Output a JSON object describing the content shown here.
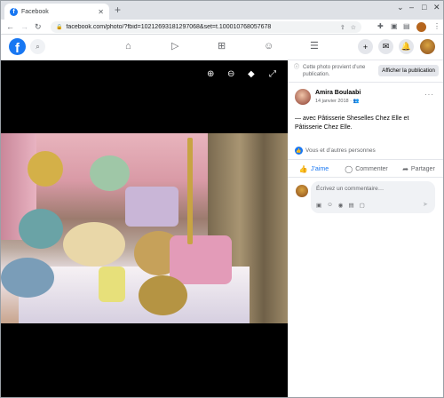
{
  "browser": {
    "tab_title": "Facebook",
    "url": "facebook.com/photo/?fbid=10212693181297068&set=t.100010768057678",
    "new_tab_label": "+",
    "window_controls": [
      "–",
      "□",
      "✕"
    ]
  },
  "fb_nav": {
    "logo": "f",
    "tabs": [
      "home-icon",
      "video-icon",
      "marketplace-icon",
      "groups-icon",
      "menu-icon"
    ],
    "right_icons": [
      "plus-icon",
      "messenger-icon",
      "bell-icon"
    ]
  },
  "viewer": {
    "controls": [
      "zoom-in-icon",
      "zoom-out-icon",
      "tag-icon",
      "fullscreen-icon"
    ]
  },
  "panel": {
    "notice": "Cette photo provient d’une publication.",
    "show_post": "Afficher la publication",
    "author": "Amira Boulaabi",
    "date": "14 janvier 2018 · ",
    "more": "···",
    "body": "— avec Pâtisserie Sheselles Chez Elle et Pâtisserie Chez Elle.",
    "reactions": "Vous et d’autres personnes",
    "actions": {
      "like": "J’aime",
      "comment": "Commenter",
      "share": "Partager"
    },
    "comment_placeholder": "Écrivez un commentaire…"
  }
}
